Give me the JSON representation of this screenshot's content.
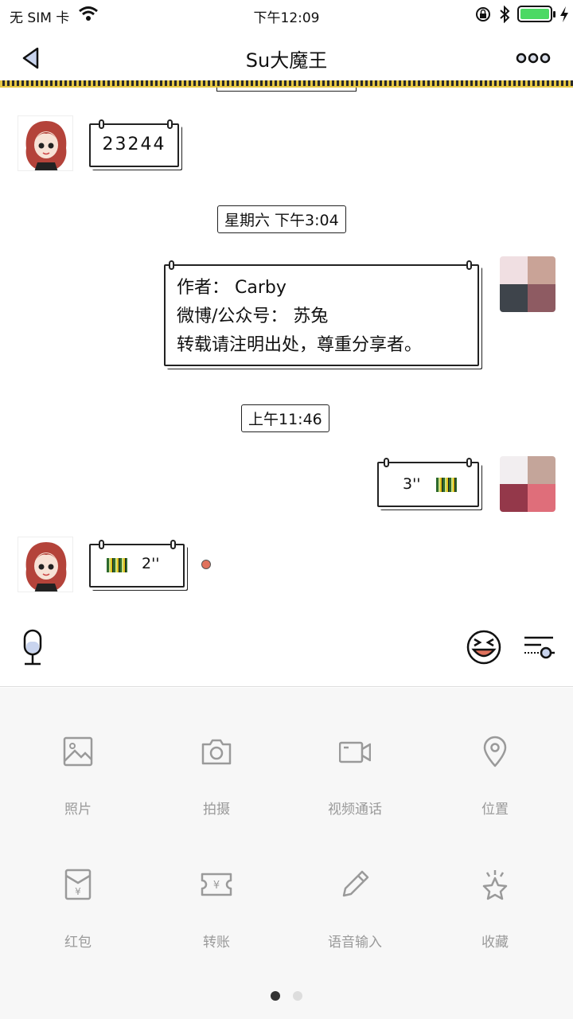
{
  "status_bar": {
    "carrier": "无 SIM 卡",
    "time": "下午12:09"
  },
  "nav": {
    "title": "Su大魔王"
  },
  "messages": {
    "m1_text": "23244",
    "ts1": "星期六 下午3:04",
    "m2_line1": "作者： Carby",
    "m2_line2": "微博/公众号： 苏兔",
    "m2_line3": "转载请注明出处，尊重分享者。",
    "ts2": "上午11:46",
    "m3_duration": "3''",
    "m4_duration": "2''"
  },
  "panel": {
    "items": [
      {
        "label": "照片",
        "icon": "photo-icon"
      },
      {
        "label": "拍摄",
        "icon": "camera-icon"
      },
      {
        "label": "视频通话",
        "icon": "video-call-icon"
      },
      {
        "label": "位置",
        "icon": "location-icon"
      },
      {
        "label": "红包",
        "icon": "red-packet-icon"
      },
      {
        "label": "转账",
        "icon": "transfer-icon"
      },
      {
        "label": "语音输入",
        "icon": "pencil-icon"
      },
      {
        "label": "收藏",
        "icon": "favorite-star-icon"
      }
    ],
    "page_indicator": {
      "pages": 2,
      "current": 1
    }
  },
  "colors": {
    "accent_border": "#e6c742",
    "panel_icon": "#9a9a9a",
    "unread_dot": "#e0725d",
    "battery": "#4cd964"
  }
}
